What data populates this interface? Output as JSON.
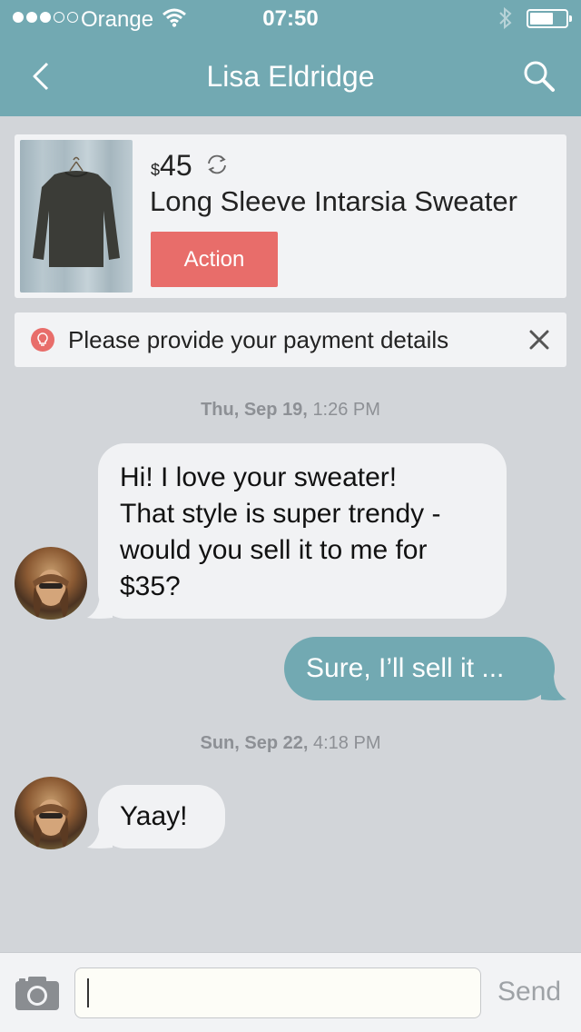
{
  "status_bar": {
    "carrier": "Orange",
    "time": "07:50",
    "signal_bars_filled": 3,
    "signal_bars_total": 5,
    "battery_level": 0.65
  },
  "nav": {
    "title": "Lisa Eldridge",
    "back_icon": "chevron-left-icon",
    "search_icon": "search-icon"
  },
  "item": {
    "currency": "$",
    "price": "45",
    "title": "Long Sleeve Intarsia Sweater",
    "action_label": "Action"
  },
  "notice": {
    "text": "Please provide your payment details",
    "icon": "lightbulb-icon"
  },
  "thread": {
    "stamp1": {
      "date": "Thu, Sep 19,",
      "time": "1:26 PM"
    },
    "msg1": {
      "line1": "Hi! I love your sweater!",
      "line2": "That style is super trendy -",
      "line3": "would you sell it to me for",
      "line4": "$35?"
    },
    "msg2": "Sure, I’ll sell it ...",
    "stamp2": {
      "date": "Sun, Sep 22,",
      "time": "4:18 PM"
    },
    "msg3": "Yaay!"
  },
  "composer": {
    "value": "",
    "send_label": "Send"
  },
  "colors": {
    "accent": "#72a9b2",
    "action": "#e86d6a",
    "background": "#d2d5d9",
    "bubble_in": "#f1f2f4"
  }
}
